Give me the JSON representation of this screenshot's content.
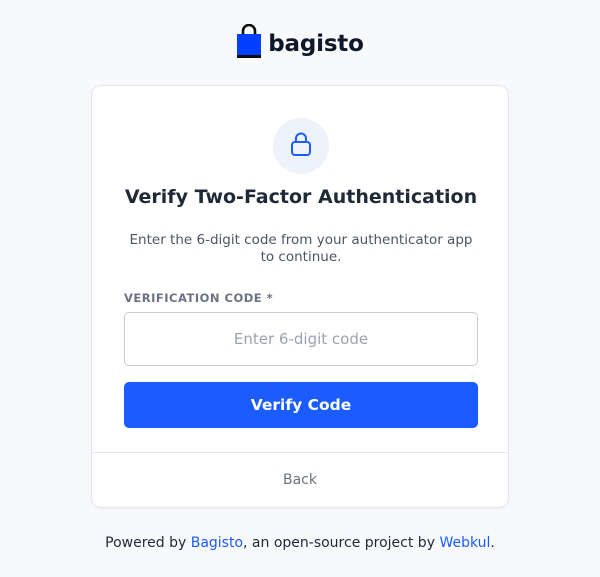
{
  "brand": {
    "name": "bagisto",
    "icon": "shopping-bag-icon",
    "icon_color": "#0041ff"
  },
  "card": {
    "icon": "lock-icon",
    "title": "Verify Two-Factor Authentication",
    "subtitle": "Enter the 6-digit code from your authenticator app to continue.",
    "field_label": "VERIFICATION CODE *",
    "input": {
      "value": "",
      "placeholder": "Enter 6-digit code"
    },
    "submit_label": "Verify Code",
    "back_label": "Back"
  },
  "footer": {
    "prefix": "Powered by ",
    "link1": "Bagisto",
    "middle": ", an open-source project by ",
    "link2": "Webkul",
    "suffix": "."
  },
  "colors": {
    "accent": "#1a5cff",
    "background": "#f8f9fb"
  }
}
